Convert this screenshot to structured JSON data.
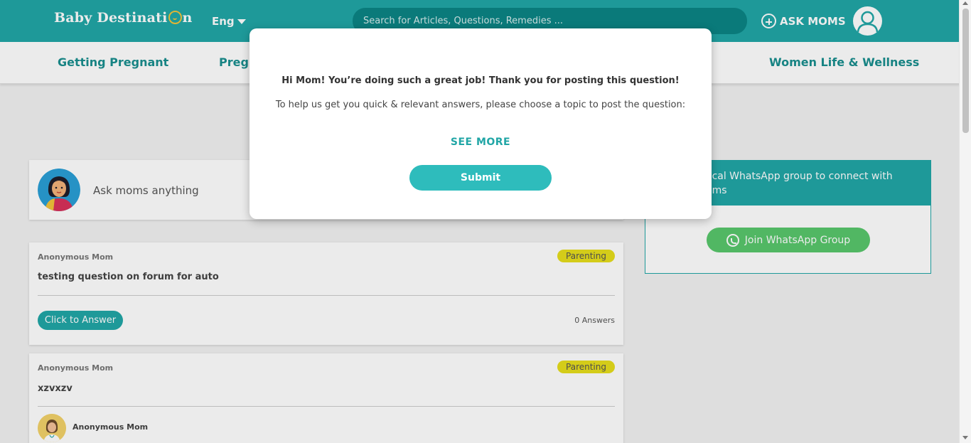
{
  "header": {
    "logo_text_left": "Baby Destinati",
    "logo_text_right": "n",
    "language": "Eng",
    "search_placeholder": "Search for Articles, Questions, Remedies ...",
    "ask_moms": "ASK MOMS"
  },
  "nav": {
    "categories": [
      "Getting Pregnant",
      "Pregr",
      "Women Life & Wellness"
    ]
  },
  "ask_box": {
    "prompt": "Ask moms anything"
  },
  "questions": [
    {
      "author": "Anonymous Mom",
      "tag": "Parenting",
      "title": "testing question on forum for auto",
      "answer_button": "Click to Answer",
      "answers_count": "0 Answers"
    },
    {
      "author": "Anonymous Mom",
      "tag": "Parenting",
      "title": "xzvxzv",
      "answerer": "Anonymous Mom"
    }
  ],
  "sidebar": {
    "heading": "ocal WhatsApp group to connect with\noms",
    "join_button": "Join WhatsApp Group"
  },
  "modal": {
    "title": "Hi Mom! You’re doing such a great job! Thank you for posting this question!",
    "message": "To help us get you quick & relevant answers, please choose a topic to post the question:",
    "see_more": "SEE MORE",
    "submit": "Submit"
  },
  "colors": {
    "brand": "#21a6a6",
    "badge": "#e6de1c",
    "whatsapp": "#58c76c"
  }
}
